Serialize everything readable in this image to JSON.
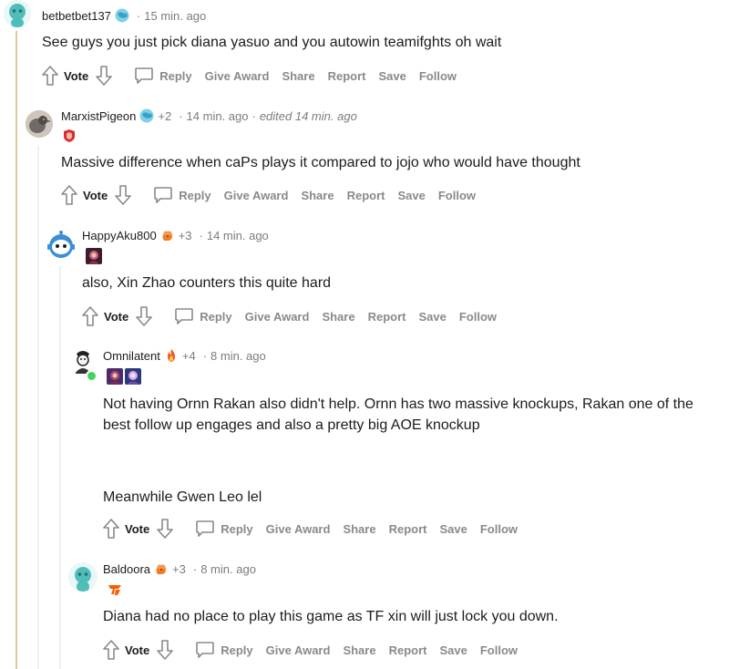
{
  "comments": [
    {
      "username": "betbetbet137",
      "karma": "",
      "time": "15 min. ago",
      "edited": "",
      "body_lines": [
        "See guys you just pick diana yasuo and you autowin teamifghts oh wait"
      ],
      "avatar_color": "#4fbdba"
    },
    {
      "username": "MarxistPigeon",
      "karma": "+2",
      "time": "14 min. ago",
      "edited": "edited 14 min. ago",
      "body_lines": [
        "Massive difference when caPs plays it compared to jojo who would have thought"
      ],
      "avatar_color": "#8a7b6c"
    },
    {
      "username": "HappyAku800",
      "karma": "+3",
      "time": "14 min. ago",
      "edited": "",
      "body_lines": [
        "also, Xin Zhao counters this quite hard"
      ],
      "avatar_color": "#3a8fd6"
    },
    {
      "username": "Omnilatent",
      "karma": "+4",
      "time": "8 min. ago",
      "edited": "",
      "body_lines": [
        "Not having Ornn Rakan also didn't help. Ornn has two massive knockups, Rakan one of the",
        "best follow up engages and also a pretty big AOE knockup",
        "Meanwhile Gwen Leo lel"
      ],
      "avatar_color": "#222222"
    },
    {
      "username": "Baldoora",
      "karma": "+3",
      "time": "8 min. ago",
      "edited": "",
      "body_lines": [
        "Diana had no place to play this game as TF xin will just lock you down."
      ],
      "avatar_color": "#4fbdba"
    }
  ],
  "actions": {
    "vote": "Vote",
    "reply": "Reply",
    "give_award": "Give Award",
    "share": "Share",
    "report": "Report",
    "save": "Save",
    "follow": "Follow"
  },
  "separator": "·",
  "colors": {
    "action_gray": "#878a8c",
    "meta_gray": "#7c7c7c",
    "thread_line": "#edeff1",
    "thread_line_gold": "#dcc9a3",
    "online": "#46d160"
  }
}
